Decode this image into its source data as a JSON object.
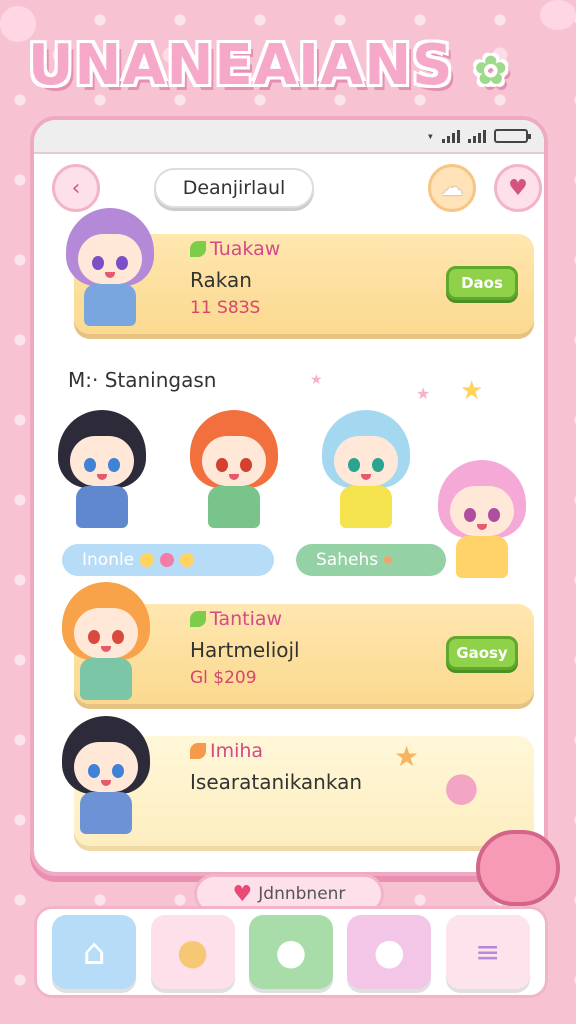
{
  "app": {
    "logo_text": "UNANEAIANS",
    "colors": {
      "accent": "#f3b4c9",
      "card": "#fbd98f",
      "button": "#8fd24a"
    }
  },
  "statusbar": {
    "signal_text": "▾ .ıl",
    "icons": [
      "wifi-icon",
      "signal-icon",
      "battery-icon"
    ]
  },
  "topbar": {
    "back_icon": "chevron-left-icon",
    "search_text": "Deanjirlaul",
    "pet_icon": "pet-icon",
    "heart_icon": "heart-icon"
  },
  "cards": [
    {
      "title": "Tuakaw",
      "subtitle": "Rakan",
      "price": "11 S8ЗS",
      "button": "Daos"
    },
    {
      "title": "Tantiaw",
      "subtitle": "Hartmeliojl",
      "price": "Gl $209",
      "button": "Gaosy"
    },
    {
      "title": "Imiha",
      "subtitle": "Isearatanikankan",
      "price": "",
      "button": ""
    }
  ],
  "section": {
    "title": "M:· Staningasn"
  },
  "pills": [
    {
      "label": "Inonle"
    },
    {
      "label": "Sahehs"
    }
  ],
  "chat_bar": {
    "label": "Jdnnbnenr"
  },
  "nav": {
    "items": [
      "home-icon",
      "bear-icon",
      "chat-icon",
      "bunny-icon",
      "menu-icon"
    ]
  }
}
